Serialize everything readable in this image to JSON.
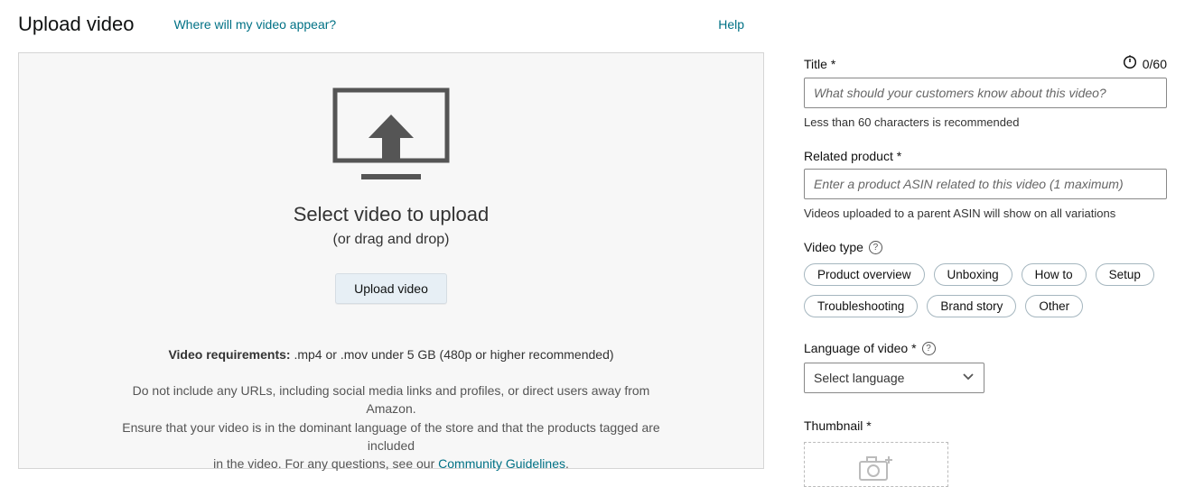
{
  "header": {
    "title": "Upload video",
    "appear_link": "Where will my video appear?",
    "help": "Help"
  },
  "dropzone": {
    "heading": "Select video to upload",
    "subheading": "(or drag and drop)",
    "button": "Upload video",
    "req_label": "Video requirements:",
    "req_text": " .mp4 or .mov under 5 GB (480p or higher recommended)",
    "note_1": "Do not include any URLs, including social media links and profiles, or direct users away from Amazon.",
    "note_2": "Ensure that your video is in the dominant language of the store and that the products tagged are included",
    "note_3_a": "in the video. For any questions, see our ",
    "note_3_link": "Community Guidelines",
    "note_3_b": "."
  },
  "form": {
    "title": {
      "label": "Title *",
      "counter": "0/60",
      "placeholder": "What should your customers know about this video?",
      "hint": "Less than 60 characters is recommended"
    },
    "related": {
      "label": "Related product *",
      "placeholder": "Enter a product ASIN related to this video (1 maximum)",
      "hint": "Videos uploaded to a parent ASIN will show on all variations"
    },
    "videotype": {
      "label": "Video type",
      "options": [
        "Product overview",
        "Unboxing",
        "How to",
        "Setup",
        "Troubleshooting",
        "Brand story",
        "Other"
      ]
    },
    "language": {
      "label": "Language of video *",
      "selected": "Select language"
    },
    "thumbnail": {
      "label": "Thumbnail *"
    }
  }
}
